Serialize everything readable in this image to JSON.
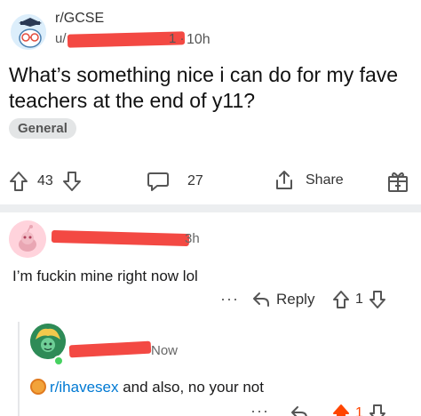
{
  "post": {
    "subreddit": "r/GCSE",
    "time": "10h",
    "title": "What’s something nice i can do for my fave teachers at the end of y11?",
    "flair": "General",
    "upvotes": "43",
    "comments": "27",
    "share_label": "Share"
  },
  "comment1": {
    "time": "3h",
    "body": "I’m fuckin mine right now lol",
    "more": "···",
    "reply_label": "Reply",
    "votes": "1"
  },
  "comment2": {
    "time": "Now",
    "subreddit_link": "r/ihavesex",
    "body": " and also, no your not",
    "more": "···",
    "votes": "1"
  },
  "colors": {
    "redaction": "#f23a33",
    "upvote_active": "#ff4500",
    "link": "#0079d3"
  }
}
